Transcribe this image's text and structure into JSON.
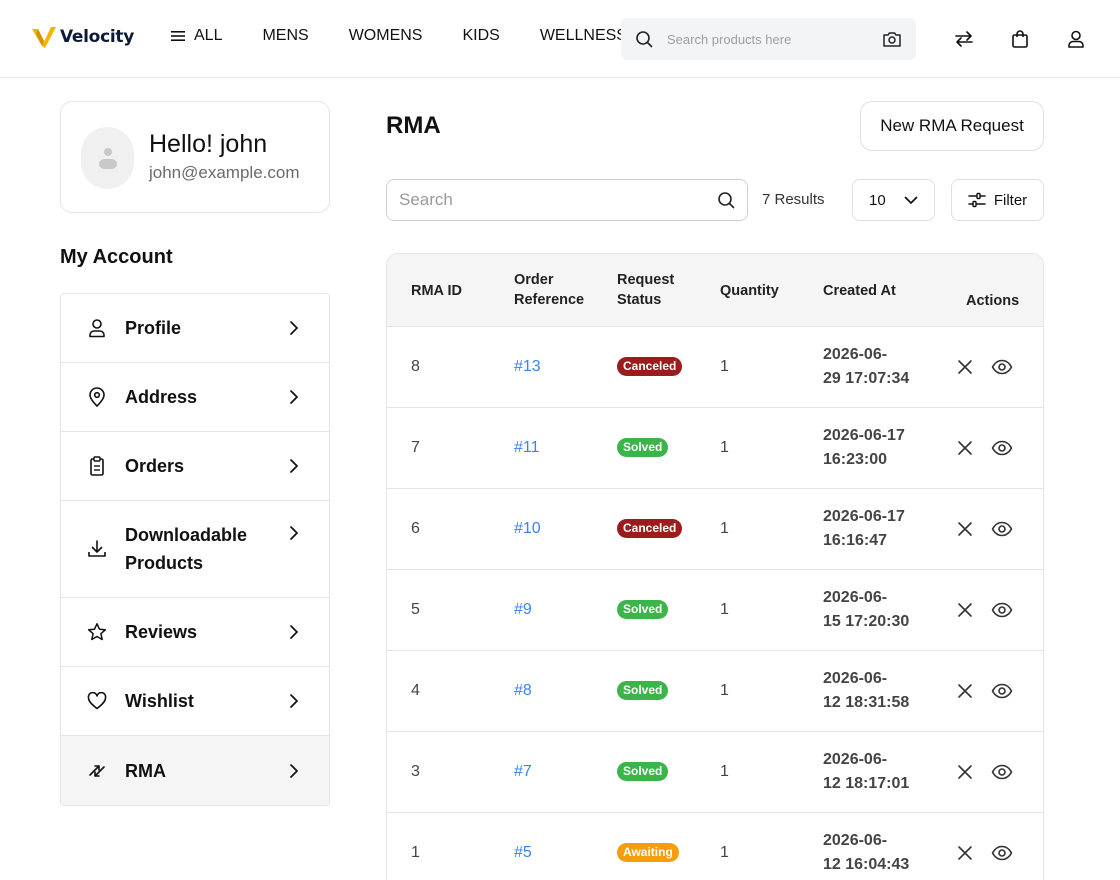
{
  "header": {
    "logo_text": "Velocity",
    "nav": [
      {
        "label": "ALL",
        "icon": "menu-icon"
      },
      {
        "label": "MENS"
      },
      {
        "label": "WOMENS"
      },
      {
        "label": "KIDS"
      },
      {
        "label": "WELLNESS"
      }
    ],
    "search_placeholder": "Search products here",
    "icons": [
      "search-icon",
      "camera-icon",
      "compare-icon",
      "bag-icon",
      "user-icon"
    ]
  },
  "user_card": {
    "greeting": "Hello! john",
    "email": "john@example.com"
  },
  "account": {
    "title": "My Account",
    "items": [
      {
        "label": "Profile",
        "icon": "user-icon"
      },
      {
        "label": "Address",
        "icon": "location-pin-icon"
      },
      {
        "label": "Orders",
        "icon": "clipboard-icon"
      },
      {
        "label": "Downloadable Products",
        "icon": "download-icon"
      },
      {
        "label": "Reviews",
        "icon": "star-icon"
      },
      {
        "label": "Wishlist",
        "icon": "heart-icon"
      },
      {
        "label": "RMA",
        "icon": "exchange-icon",
        "active": true
      }
    ]
  },
  "main": {
    "title": "RMA",
    "new_button": "New RMA Request",
    "search_placeholder": "Search",
    "results": "7 Results",
    "per_page": "10",
    "filter_label": "Filter"
  },
  "table": {
    "headers": {
      "rma_id": "RMA ID",
      "order_ref_1": "Order",
      "order_ref_2": "Reference",
      "status_1": "Request",
      "status_2": "Status",
      "quantity": "Quantity",
      "created_at": "Created At",
      "actions": "Actions"
    },
    "rows": [
      {
        "id": "8",
        "ref": "#13",
        "status": "Canceled",
        "qty": "1",
        "date_1": "2026-06-",
        "date_2": "29 17:07:34"
      },
      {
        "id": "7",
        "ref": "#11",
        "status": "Solved",
        "qty": "1",
        "date_1": "2026-06-17",
        "date_2": "16:23:00"
      },
      {
        "id": "6",
        "ref": "#10",
        "status": "Canceled",
        "qty": "1",
        "date_1": "2026-06-17",
        "date_2": "16:16:47"
      },
      {
        "id": "5",
        "ref": "#9",
        "status": "Solved",
        "qty": "1",
        "date_1": "2026-06-",
        "date_2": "15 17:20:30"
      },
      {
        "id": "4",
        "ref": "#8",
        "status": "Solved",
        "qty": "1",
        "date_1": "2026-06-",
        "date_2": "12 18:31:58"
      },
      {
        "id": "3",
        "ref": "#7",
        "status": "Solved",
        "qty": "1",
        "date_1": "2026-06-",
        "date_2": "12 18:17:01"
      },
      {
        "id": "1",
        "ref": "#5",
        "status": "Awaiting",
        "qty": "1",
        "date_1": "2026-06-",
        "date_2": "12 16:04:43"
      }
    ]
  },
  "colors": {
    "canceled": "#9b1c1c",
    "solved": "#3bb54a",
    "awaiting": "#f59e0b",
    "link": "#3b82f6",
    "logo_yellow": "#f5b400"
  }
}
